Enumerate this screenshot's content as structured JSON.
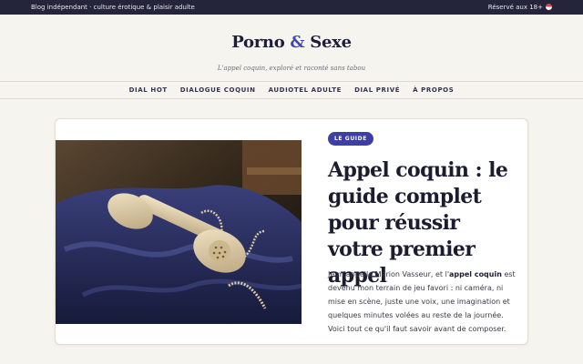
{
  "topbar": {
    "left_text": "Blog indépendant · culture érotique & plaisir adulte",
    "right_text": "Réservé aux 18+"
  },
  "site": {
    "title_part1": "Porno",
    "title_amp": "&",
    "title_part2": "Sexe",
    "tagline": "L'appel coquin, exploré et raconté sans tabou"
  },
  "nav": {
    "items": [
      {
        "label": "DIAL HOT"
      },
      {
        "label": "DIALOGUE COQUIN"
      },
      {
        "label": "AUDIOTEL ADULTE"
      },
      {
        "label": "DIAL PRIVÉ"
      },
      {
        "label": "À PROPOS"
      }
    ]
  },
  "article": {
    "badge": "LE GUIDE",
    "title": "Appel coquin : le guide complet pour réussir votre premier appel",
    "excerpt_before": "Je m'appelle Marion Vasseur, et l'",
    "excerpt_bold": "appel coquin",
    "excerpt_after": " est devenu mon terrain de jeu favori : ni caméra, ni mise en scène, juste une voix, une imagination et quelques minutes volées au reste de la journée. Voici tout ce qu'il faut savoir avant de composer."
  },
  "colors": {
    "topbar_bg": "#24243a",
    "accent": "#3d3fa3",
    "page_bg": "#f6f4ef"
  }
}
